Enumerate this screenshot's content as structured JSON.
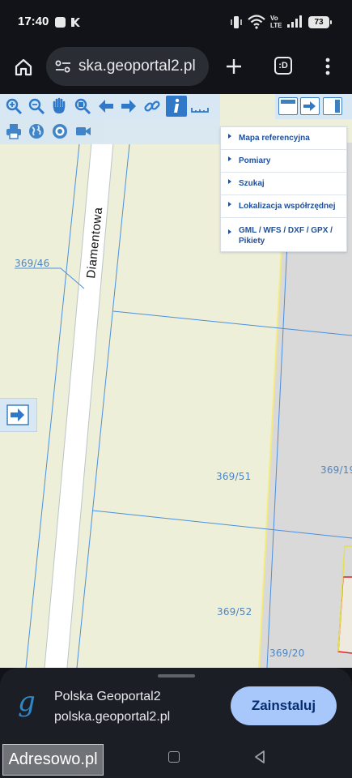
{
  "status_bar": {
    "time": "17:40",
    "battery": "73",
    "icons": [
      "app-notification-icon",
      "k-app-icon",
      "vibrate-icon",
      "wifi-icon",
      "volte-icon",
      "signal-icon",
      "battery-icon"
    ],
    "volte_top": "Vo",
    "volte_bottom": "LTE"
  },
  "browser": {
    "url": "polska.geoportal2.pl",
    "url_visible": "ska.geoportal2.pl",
    "tab_count": ":D"
  },
  "map": {
    "street_name": "Diamentowa",
    "parcels": [
      "369/46",
      "369/51",
      "369/19",
      "369/52",
      "369/20"
    ],
    "toolbar_tools": [
      "zoom-in",
      "zoom-out",
      "pan-hand",
      "zoom-window",
      "back",
      "forward",
      "link",
      "info",
      "measure",
      "print",
      "globe",
      "target",
      "camera"
    ],
    "menu": [
      "Mapa referencyjna",
      "Pomiary",
      "Szukaj",
      "Lokalizacja współrzędnej",
      "GML / WFS / DXF / GPX / Pikiety"
    ]
  },
  "install_banner": {
    "app_name": "Polska Geoportal2",
    "app_url": "polska.geoportal2.pl",
    "install_label": "Zainstaluj",
    "logo_letter": "g"
  },
  "watermark": "Adresowo.pl",
  "colors": {
    "map_background": "#eeefd9",
    "parcel_line": "#4a8fe0",
    "accent": "#a8c7fa",
    "menu_text": "#1f4f9a"
  }
}
